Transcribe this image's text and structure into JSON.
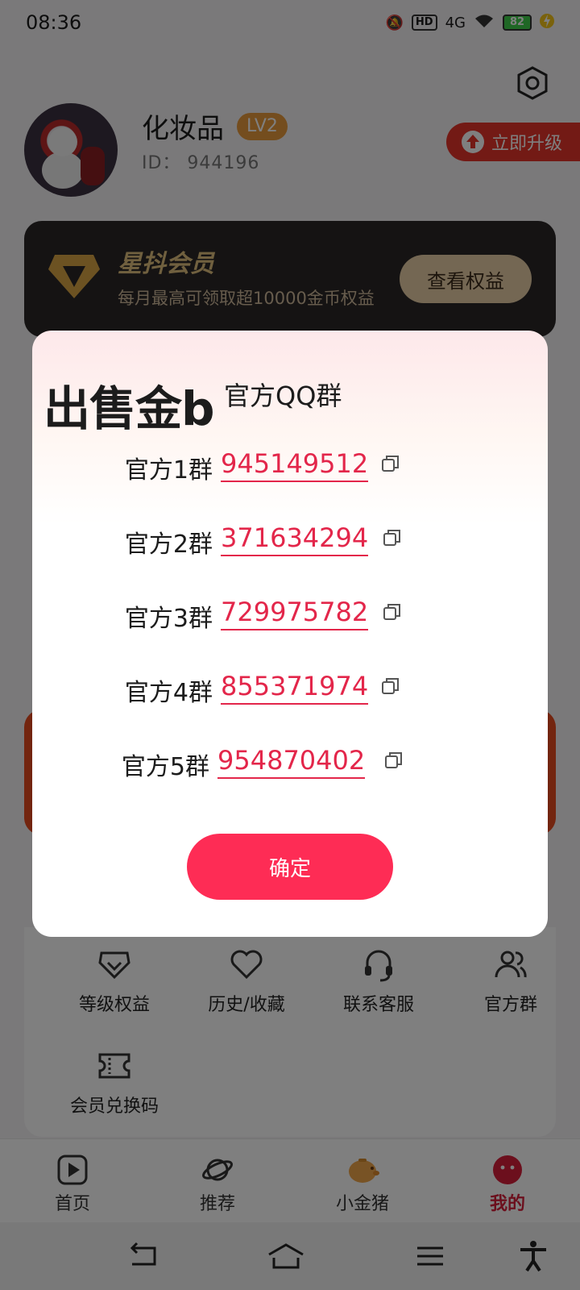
{
  "status_bar": {
    "time": "08:36",
    "hd": "HD",
    "network": "4G",
    "battery": "82"
  },
  "profile": {
    "name": "化妆品",
    "level": "LV2",
    "id_text": "ID：  944196",
    "upgrade_label": "立即升级"
  },
  "vip": {
    "title": "星抖会员",
    "subtitle": "每月最高可领取超10000金币权益",
    "button": "查看权益"
  },
  "tools": [
    {
      "label": "等级权益",
      "icon": "diamond-icon"
    },
    {
      "label": "历史/收藏",
      "icon": "heart-icon"
    },
    {
      "label": "联系客服",
      "icon": "headset-icon"
    },
    {
      "label": "官方群",
      "icon": "users-icon"
    },
    {
      "label": "会员兑换码",
      "icon": "ticket-icon"
    }
  ],
  "nav": [
    {
      "label": "首页",
      "icon": "play-icon"
    },
    {
      "label": "推荐",
      "icon": "planet-icon"
    },
    {
      "label": "小金猪",
      "icon": "piggy-icon"
    },
    {
      "label": "我的",
      "icon": "smile-icon"
    }
  ],
  "dialog": {
    "brand": "出售金b",
    "title": "官方QQ群",
    "groups": [
      {
        "label": "官方1群",
        "number": "945149512"
      },
      {
        "label": "官方2群",
        "number": "371634294"
      },
      {
        "label": "官方3群",
        "number": "729975782"
      },
      {
        "label": "官方4群",
        "number": "855371974"
      },
      {
        "label": "官方5群",
        "number": "954870402"
      }
    ],
    "confirm": "确定"
  },
  "colors": {
    "accent": "#fe2c55",
    "link": "#e3264a",
    "upgrade": "#e7342a",
    "vip_gold": "#e0c07e"
  }
}
